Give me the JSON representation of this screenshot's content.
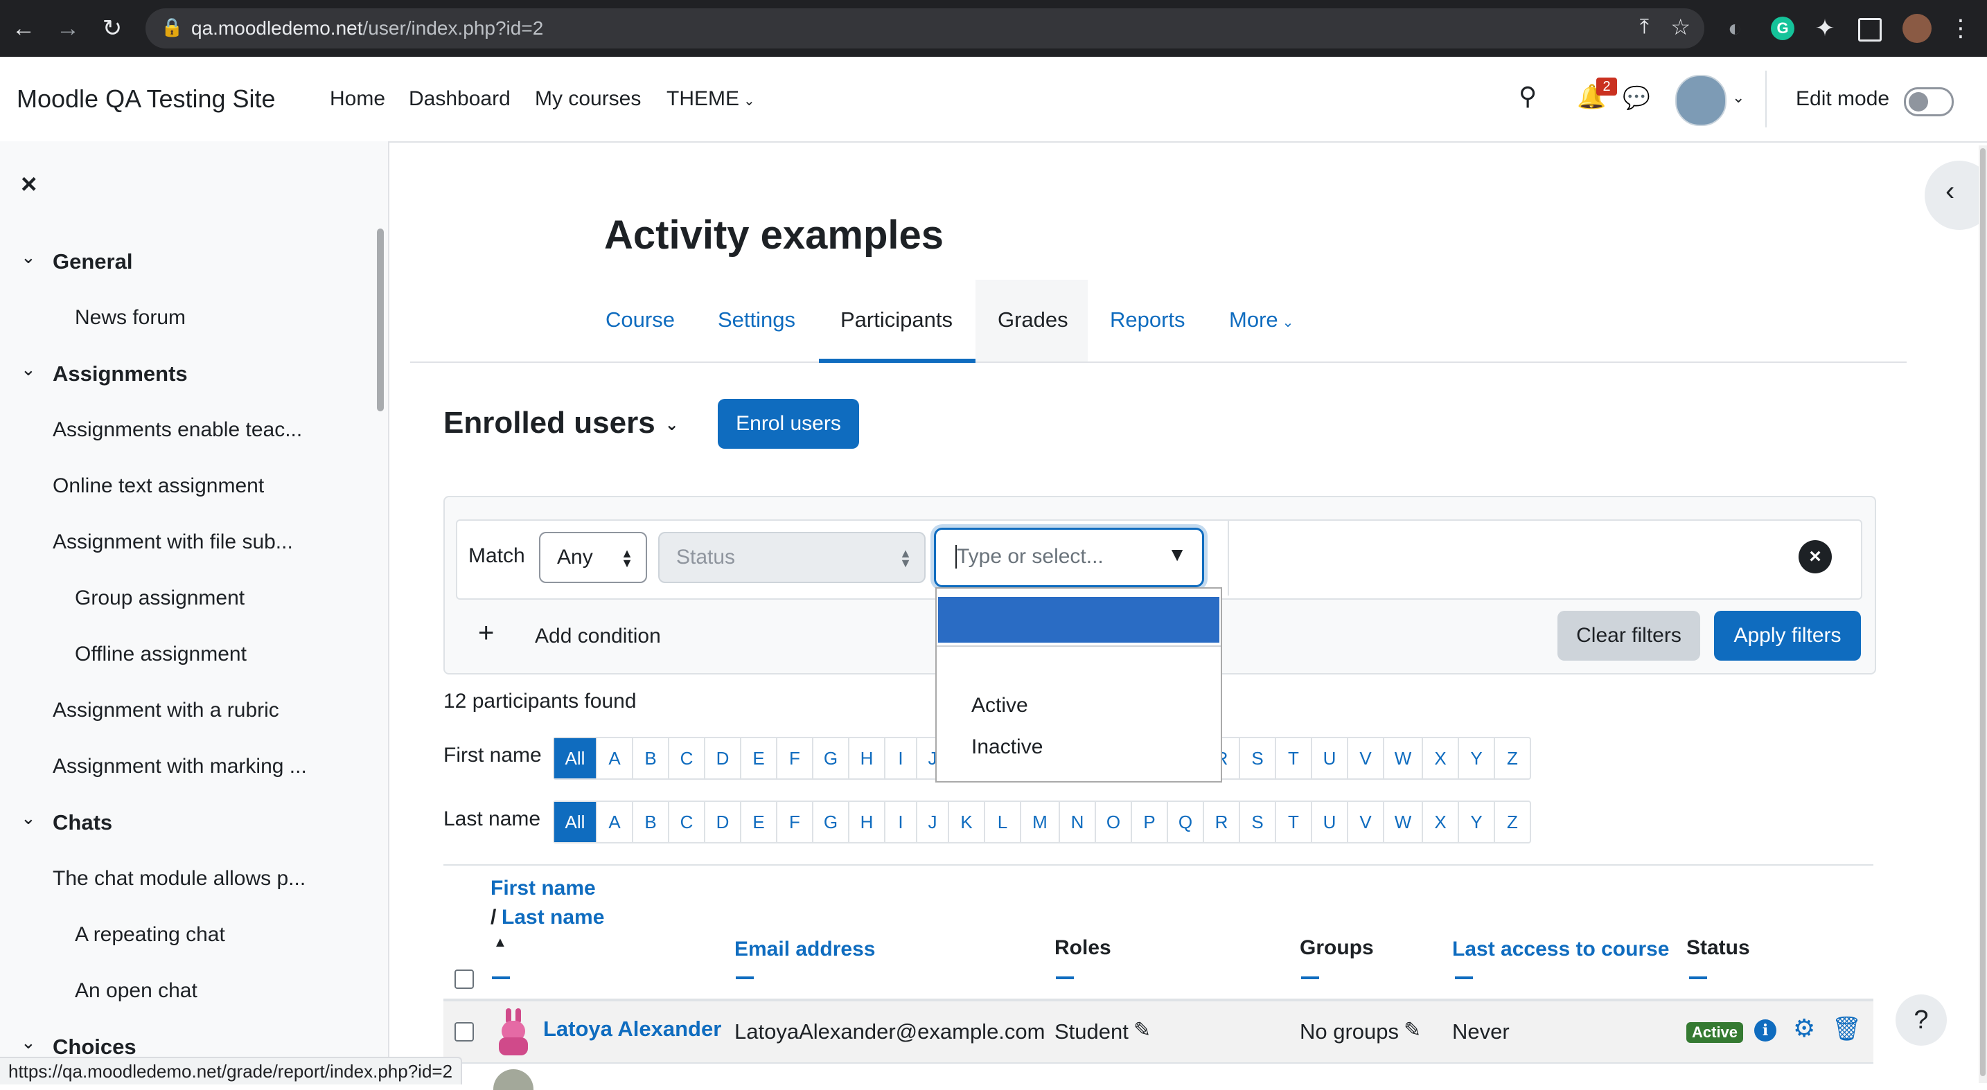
{
  "browser": {
    "url_host": "qa.moodledemo.net",
    "url_path": "/user/index.php?id=2",
    "status_url": "https://qa.moodledemo.net/grade/report/index.php?id=2"
  },
  "navbar": {
    "site_name": "Moodle QA Testing Site",
    "links": [
      "Home",
      "Dashboard",
      "My courses",
      "THEME"
    ],
    "notification_count": "2",
    "edit_mode_label": "Edit mode"
  },
  "drawer": {
    "close_label": "×",
    "sections": [
      {
        "title": "General",
        "items": [
          "News forum"
        ]
      },
      {
        "title": "Assignments",
        "items": [
          "Assignments enable teac...",
          "Online text assignment",
          "Assignment with file sub...",
          "Group assignment",
          "Offline assignment",
          "Assignment with a rubric",
          "Assignment with marking ..."
        ]
      },
      {
        "title": "Chats",
        "items": [
          "The chat module allows p...",
          "A repeating chat",
          "An open chat"
        ]
      },
      {
        "title": "Choices",
        "items": []
      }
    ]
  },
  "page": {
    "title": "Activity examples",
    "tabs": [
      "Course",
      "Settings",
      "Participants",
      "Grades",
      "Reports",
      "More"
    ],
    "heading": "Enrolled users",
    "enrol_button": "Enrol users"
  },
  "filters": {
    "match_label": "Match",
    "match_value": "Any",
    "type_value": "Status",
    "value_placeholder": "Type or select...",
    "dropdown_options": [
      "",
      "Active",
      "Inactive"
    ],
    "add_condition": "Add condition",
    "clear_button": "Clear filters",
    "apply_button": "Apply filters"
  },
  "results": {
    "count_text": "12 participants found",
    "firstname_label": "First name",
    "lastname_label": "Last name",
    "letters": [
      "All",
      "A",
      "B",
      "C",
      "D",
      "E",
      "F",
      "G",
      "H",
      "I",
      "J",
      "K",
      "L",
      "M",
      "N",
      "O",
      "P",
      "Q",
      "R",
      "S",
      "T",
      "U",
      "V",
      "W",
      "X",
      "Y",
      "Z"
    ]
  },
  "table": {
    "headers": {
      "first_name": "First name",
      "slash": "/",
      "last_name": "Last name",
      "email": "Email address",
      "roles": "Roles",
      "groups": "Groups",
      "last_access": "Last access to course",
      "status": "Status"
    },
    "rows": [
      {
        "name": "Latoya Alexander",
        "email": "LatoyaAlexander@example.com",
        "role": "Student",
        "groups": "No groups",
        "last_access": "Never",
        "status": "Active"
      }
    ]
  },
  "help_label": "?"
}
